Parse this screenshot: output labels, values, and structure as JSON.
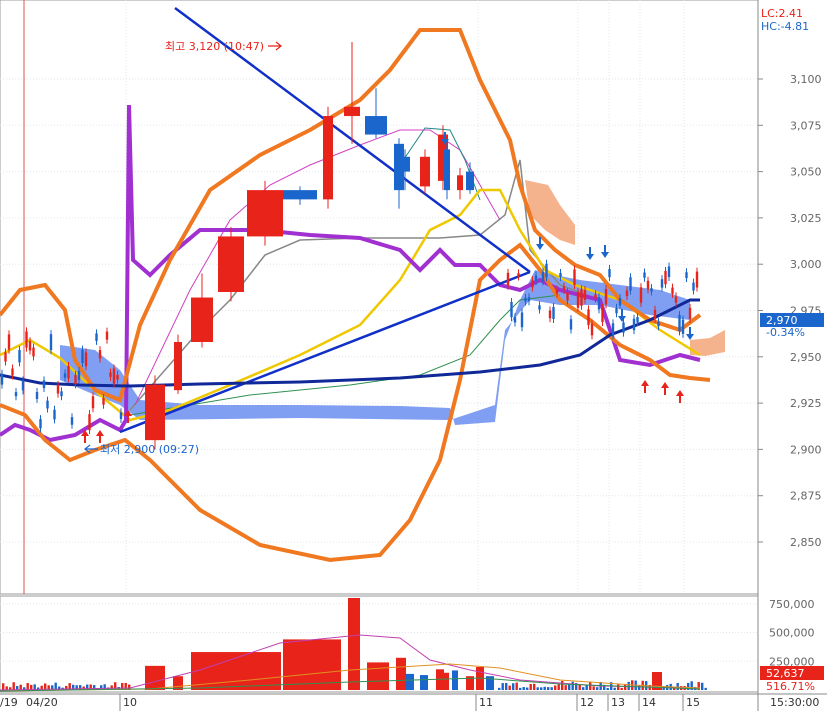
{
  "header": {
    "lc_label": "LC:2.41",
    "hc_label": "HC:-4.81"
  },
  "price_panel": {
    "y_ticks": [
      "3,100",
      "3,075",
      "3,050",
      "3,025",
      "3,000",
      "2,975",
      "2,950",
      "2,925",
      "2,900",
      "2,875",
      "2,850"
    ],
    "current_price": "2,970",
    "current_change": "-0.34%",
    "high_annotation": "최고 3,120 (10:47)",
    "low_annotation": "최저 2,900 (09:27)"
  },
  "volume_panel": {
    "y_ticks": [
      "750,000",
      "500,000",
      "250,000"
    ],
    "current_volume": "52,637",
    "current_ratio": "516.71%"
  },
  "x_axis": {
    "labels": [
      "/19",
      "04/20",
      "10",
      "11",
      "12",
      "13",
      "14",
      "15",
      "15:30:00"
    ]
  },
  "colors": {
    "up": "#e8231a",
    "down": "#1a66cc",
    "bollinger": "#f07820",
    "ma_purple": "#a030d0",
    "ma_yellow": "#f0c800",
    "trend": "#1030c8",
    "cloud_blue": "#6a8ef0",
    "cloud_orange": "#f2a070"
  },
  "chart_data": [
    {
      "type": "candlestick",
      "title": "",
      "y_range": [
        2840,
        3130
      ],
      "high": {
        "value": 3120,
        "time": "10:47"
      },
      "low": {
        "value": 2900,
        "time": "09:27"
      },
      "current": 2970,
      "change_pct": -0.34,
      "candles_10h": [
        {
          "open": 2905,
          "close": 2935,
          "high": 2940,
          "low": 2900
        },
        {
          "open": 2932,
          "close": 2958,
          "high": 2962,
          "low": 2930
        },
        {
          "open": 2958,
          "close": 2982,
          "high": 2995,
          "low": 2955
        },
        {
          "open": 2985,
          "close": 3015,
          "high": 3020,
          "low": 2980
        },
        {
          "open": 3015,
          "close": 3040,
          "high": 3045,
          "low": 3010
        },
        {
          "open": 3040,
          "close": 3035,
          "high": 3042,
          "low": 3032
        },
        {
          "open": 3035,
          "close": 3080,
          "high": 3085,
          "low": 3030
        },
        {
          "open": 3080,
          "close": 3085,
          "high": 3120,
          "low": 3065
        },
        {
          "open": 3080,
          "close": 3070,
          "high": 3095,
          "low": 3068
        },
        {
          "open": 3065,
          "close": 3040,
          "high": 3068,
          "low": 3030
        },
        {
          "open": 3058,
          "close": 3050,
          "high": 3062,
          "low": 3040
        },
        {
          "open": 3042,
          "close": 3058,
          "high": 3062,
          "low": 3038
        },
        {
          "open": 3045,
          "close": 3070,
          "high": 3075,
          "low": 3040
        },
        {
          "open": 3062,
          "close": 3040,
          "high": 3065,
          "low": 3035
        },
        {
          "open": 3040,
          "close": 3048,
          "high": 3052,
          "low": 3035
        },
        {
          "open": 3050,
          "close": 3040,
          "high": 3055,
          "low": 3038
        }
      ]
    },
    {
      "type": "bar",
      "title": "",
      "y_range": [
        0,
        800000
      ],
      "current_volume": 52637,
      "ratio_pct": 516.71,
      "main_bars": [
        {
          "value": 210000,
          "color": "up"
        },
        {
          "value": 120000,
          "color": "up"
        },
        {
          "value": 330000,
          "color": "up"
        },
        {
          "value": 330000,
          "color": "up"
        },
        {
          "value": 440000,
          "color": "up"
        },
        {
          "value": 800000,
          "color": "up"
        },
        {
          "value": 240000,
          "color": "up"
        },
        {
          "value": 280000,
          "color": "up"
        },
        {
          "value": 140000,
          "color": "down"
        },
        {
          "value": 130000,
          "color": "down"
        },
        {
          "value": 180000,
          "color": "up"
        },
        {
          "value": 150000,
          "color": "up"
        },
        {
          "value": 170000,
          "color": "down"
        },
        {
          "value": 120000,
          "color": "up"
        },
        {
          "value": 200000,
          "color": "up"
        },
        {
          "value": 120000,
          "color": "down"
        }
      ]
    }
  ]
}
